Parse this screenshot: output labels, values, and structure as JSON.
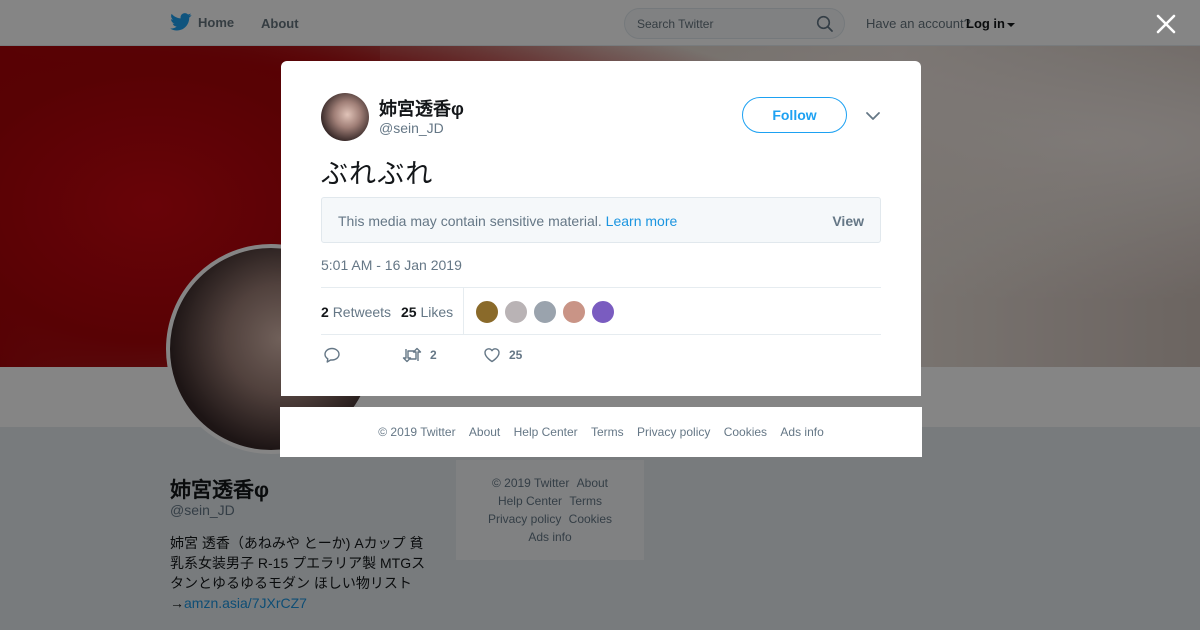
{
  "nav": {
    "home_label": "Home",
    "about_label": "About",
    "search_placeholder": "Search Twitter",
    "have_account": "Have an account?",
    "login_label": "Log in"
  },
  "profile": {
    "name": "姉宮透香φ",
    "handle": "@sein_JD",
    "bio": "姉宮 透香（あねみや とーか) Aカップ 貧乳系女装男子 R-15 プエラリア製 MTGスタンとゆるゆるモダン ほしい物リスト→",
    "bio_link": "amzn.asia/7JXrCZ7"
  },
  "side_footer": {
    "links": [
      "© 2019 Twitter",
      "About",
      "Help Center",
      "Terms",
      "Privacy policy",
      "Cookies",
      "Ads info"
    ]
  },
  "tweet": {
    "name": "姉宮透香φ",
    "handle": "@sein_JD",
    "follow_label": "Follow",
    "text": "ぶれぶれ",
    "sensitive_notice": "This media may contain sensitive material.",
    "learn_more": "Learn more",
    "view_label": "View",
    "timestamp": "5:01 AM - 16 Jan 2019",
    "retweets_count": "2",
    "retweets_label": "Retweets",
    "likes_count": "25",
    "likes_label": "Likes",
    "action_retweet_count": "2",
    "action_like_count": "25",
    "likers": [
      {
        "color": "#8a6a2a"
      },
      {
        "color": "#b9b3b5"
      },
      {
        "color": "#9aa3ad"
      },
      {
        "color": "#c99486"
      },
      {
        "color": "#7a5cc0"
      }
    ]
  },
  "modal_footer": {
    "links": [
      "© 2019 Twitter",
      "About",
      "Help Center",
      "Terms",
      "Privacy policy",
      "Cookies",
      "Ads info"
    ]
  },
  "colors": {
    "accent": "#1da1f2",
    "link": "#1b95e0",
    "muted": "#657786"
  }
}
